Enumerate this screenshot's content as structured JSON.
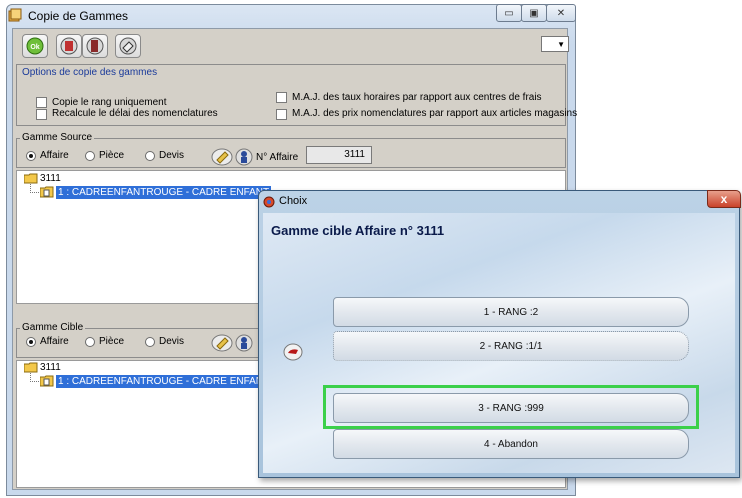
{
  "main_window": {
    "title": "Copie de Gammes",
    "caption_buttons": {
      "minimize": "▭",
      "maximize": "▣",
      "close": "✕"
    },
    "toolbar": {
      "ok_label": "Ok",
      "icons": [
        "ok-icon",
        "exit-icon",
        "door-icon",
        "eraser-icon"
      ]
    },
    "options": {
      "title": "Options de copie des gammes",
      "left_checks": [
        "Copie le rang uniquement",
        "Recalcule le délai des nomenclatures"
      ],
      "right_checks": [
        "M.A.J. des taux horaires par rapport aux centres de frais",
        "M.A.J. des prix nomenclatures par rapport aux articles magasins"
      ]
    },
    "source": {
      "title": "Gamme Source",
      "radios": [
        "Affaire",
        "Pièce",
        "Devis"
      ],
      "selected": "Affaire",
      "affaire_label": "N° Affaire",
      "affaire_value": "3111",
      "tree_root": "3111",
      "tree_item": "1 : CADREENFANTROUGE - CADRE ENFANT"
    },
    "cible": {
      "title": "Gamme Cible",
      "radios": [
        "Affaire",
        "Pièce",
        "Devis"
      ],
      "selected": "Affaire",
      "tree_root": "3111",
      "tree_item": "1 : CADREENFANTROUGE - CADRE ENFANT"
    }
  },
  "dialog": {
    "title": "Choix",
    "close_label": "x",
    "heading": "Gamme cible Affaire n° 3111",
    "choices": [
      "1 - RANG :2",
      "2 - RANG :1/1",
      "3 - RANG :999",
      "4 - Abandon"
    ],
    "highlighted_choice": "3 - RANG :999"
  }
}
